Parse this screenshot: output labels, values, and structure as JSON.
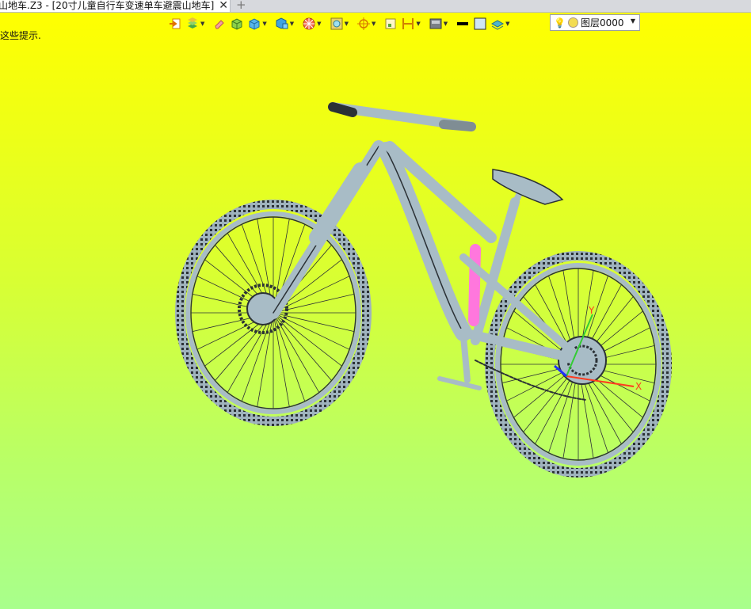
{
  "tab": {
    "title": "山地车.Z3 - [20寸儿童自行车变速单车避震山地车]",
    "close_glyph": "✕",
    "new_tab_glyph": "+"
  },
  "viewport": {
    "hint": "这些提示."
  },
  "toolbar": {
    "icons": [
      "exit-sketch-icon",
      "sketch-layers-icon",
      "eraser-icon",
      "box-solid-icon",
      "cube-icon",
      "view-cube-icon",
      "render-mode-icon",
      "wireframe-icon",
      "snap-point-icon",
      "rectangle-select-icon",
      "measure-icon",
      "display-shade-icon",
      "line-color-icon",
      "fill-color-icon",
      "layer-style-icon"
    ],
    "layer": {
      "bulb": "💡",
      "name": "图层0000"
    }
  },
  "model": {
    "label": "bicycle-3d-model",
    "axis_x": "X",
    "axis_y": "Y",
    "colors": {
      "frame": "#a8bcc6",
      "outline": "#2b3136",
      "highlight": "#ff77dd",
      "axis_x": "#ff3b1f",
      "axis_y": "#33cc33",
      "axis_z": "#1f2fff"
    }
  }
}
